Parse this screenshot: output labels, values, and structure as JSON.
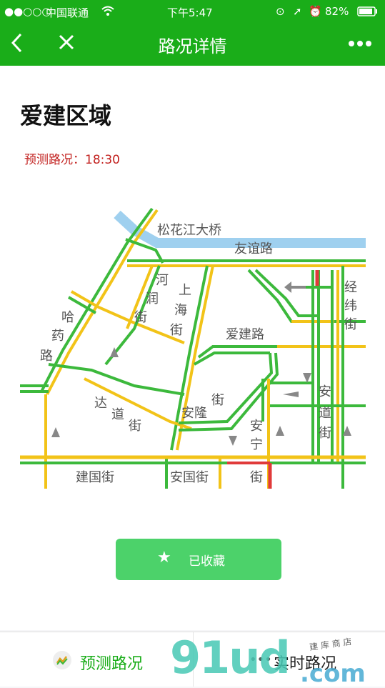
{
  "status_bar": {
    "signal": "●●○○○",
    "carrier": "中国联通",
    "wifi": "wifi-icon",
    "time": "下午5:47",
    "battery": "82%"
  },
  "nav": {
    "title": "路况详情",
    "back_icon": "chevron-left-icon",
    "close_icon": "close-icon",
    "more_icon": "more-dots-icon"
  },
  "page": {
    "area_title": "爱建区域",
    "prediction": "预测路况：18:30"
  },
  "map": {
    "labels": {
      "bridge": "松花江大桥",
      "youyi": "友谊路",
      "hehe": "河润街",
      "shanghai": "上海街",
      "jingwei": "经纬街",
      "hayao": "哈药路",
      "aijian": "爱建路",
      "dadao": "达道街",
      "anlong": "安隆街",
      "anning": "安宁街",
      "andao": "安道街",
      "jianguo": "建国街",
      "anguo": "安国街"
    },
    "colors": {
      "smooth": "#3cb93c",
      "slow": "#f2c318",
      "jam": "#e03a3a",
      "river": "#9fd0ef"
    }
  },
  "favorite_button": {
    "label": "已收藏",
    "icon": "star-icon"
  },
  "tabbar": {
    "tab1": "预测路况",
    "tab2": "实时路况"
  },
  "watermark": {
    "main": "91ud",
    "dom": ".com",
    "small": "建 库 商 店"
  }
}
